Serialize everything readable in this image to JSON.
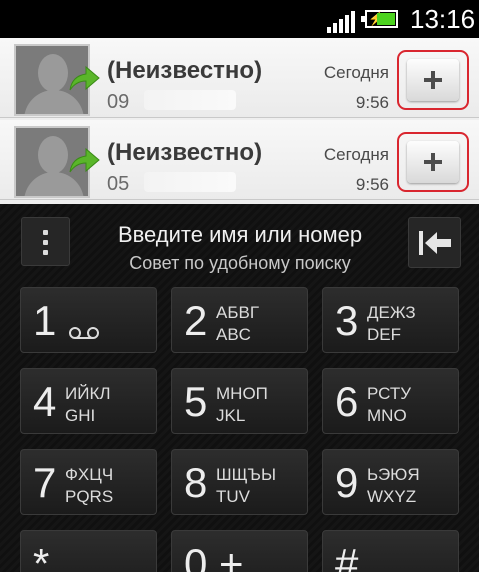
{
  "status_bar": {
    "time": "13:16",
    "signal_icon": "signal-bars-icon",
    "battery_icon": "battery-charging-icon",
    "battery_color": "#4cd31f"
  },
  "call_log": [
    {
      "name": "(Неизвестно)",
      "number_visible": "09",
      "day": "Сегодня",
      "time": "9:56",
      "arrow_icon": "incoming-call-arrow-icon",
      "add_icon": "plus-icon"
    },
    {
      "name": "(Неизвестно)",
      "number_visible": "05",
      "day": "Сегодня",
      "time": "9:56",
      "arrow_icon": "incoming-call-arrow-icon",
      "add_icon": "plus-icon"
    }
  ],
  "highlight_color": "#d9262f",
  "arrow_color": "#5ab62a",
  "dialer": {
    "prompt": "Введите имя или номер",
    "hint": "Совет по удобному поиску",
    "menu_icon": "more-vertical-icon",
    "backspace_icon": "backspace-icon",
    "keys": [
      {
        "digit": "1",
        "letters_ru": "",
        "letters_en": ""
      },
      {
        "digit": "2",
        "letters_ru": "АБВГ",
        "letters_en": "ABC"
      },
      {
        "digit": "3",
        "letters_ru": "ДЕЖЗ",
        "letters_en": "DEF"
      },
      {
        "digit": "4",
        "letters_ru": "ИЙКЛ",
        "letters_en": "GHI"
      },
      {
        "digit": "5",
        "letters_ru": "МНОП",
        "letters_en": "JKL"
      },
      {
        "digit": "6",
        "letters_ru": "РСТУ",
        "letters_en": "MNO"
      },
      {
        "digit": "7",
        "letters_ru": "ФХЦЧ",
        "letters_en": "PQRS"
      },
      {
        "digit": "8",
        "letters_ru": "ШЩЪЫ",
        "letters_en": "TUV"
      },
      {
        "digit": "9",
        "letters_ru": "ЬЭЮЯ",
        "letters_en": "WXYZ"
      },
      {
        "digit": "*",
        "letters_ru": "",
        "letters_en": ""
      },
      {
        "digit": "0 +",
        "letters_ru": "",
        "letters_en": ""
      },
      {
        "digit": "#",
        "letters_ru": "",
        "letters_en": ""
      }
    ],
    "voicemail_icon": "voicemail-icon"
  }
}
